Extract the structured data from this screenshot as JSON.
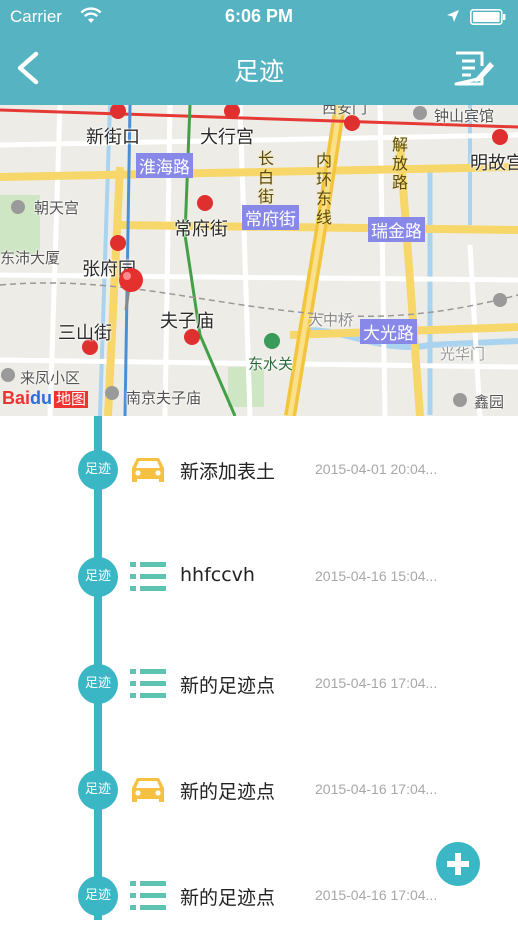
{
  "status": {
    "carrier": "Carrier",
    "time": "6:06 PM"
  },
  "nav": {
    "title": "足迹",
    "back_icon": "chevron-left-icon",
    "edit_icon": "edit-note-icon"
  },
  "map": {
    "labels": {
      "xinjiekou": "新街口",
      "daxinggong": "大行宫",
      "huaihai_road": "淮海路",
      "changbai_st": "长白街",
      "neihuan_east": "内环东线",
      "jiefang_road": "解放路",
      "mingpalace": "明故宫",
      "zhongshan_hotel": "钟山宾馆",
      "ximen": "西安门",
      "chaotiangong": "朝天宫",
      "changfujie_station": "常府街",
      "changfujie_road": "常府街",
      "ruijin_road": "瑞金路",
      "dongshi_building": "东沛大厦",
      "zhangfuyuan": "张府园",
      "sanshanjie": "三山街",
      "fuzimiao": "夫子庙",
      "dazhongqiao": "大中桥",
      "daguang_road": "大光路",
      "dongshuiguan": "东水关",
      "guanghuamen": "光华门",
      "laifeng": "来凤小区",
      "nanjing_fuzimiao": "南京夫子庙",
      "xinlang": "鑫园"
    },
    "logo": {
      "text": "Bai",
      "paw": "du",
      "suffix": "地图"
    }
  },
  "footprints": [
    {
      "badge": "足迹",
      "icon": "car-icon",
      "title": "新添加表土",
      "date": "2015-04-01 20:04..."
    },
    {
      "badge": "足迹",
      "icon": "list-icon",
      "title": "hhfccvh",
      "date": "2015-04-16 15:04..."
    },
    {
      "badge": "足迹",
      "icon": "list-icon",
      "title": "新的足迹点",
      "date": "2015-04-16 17:04..."
    },
    {
      "badge": "足迹",
      "icon": "car-icon",
      "title": "新的足迹点",
      "date": "2015-04-16 17:04..."
    },
    {
      "badge": "足迹",
      "icon": "list-icon",
      "title": "新的足迹点",
      "date": "2015-04-16 17:04..."
    }
  ],
  "colors": {
    "accent": "#3ab6c4",
    "nav_bg": "#56b3c2",
    "car": "#f6c143",
    "list": "#5fc3b2"
  }
}
